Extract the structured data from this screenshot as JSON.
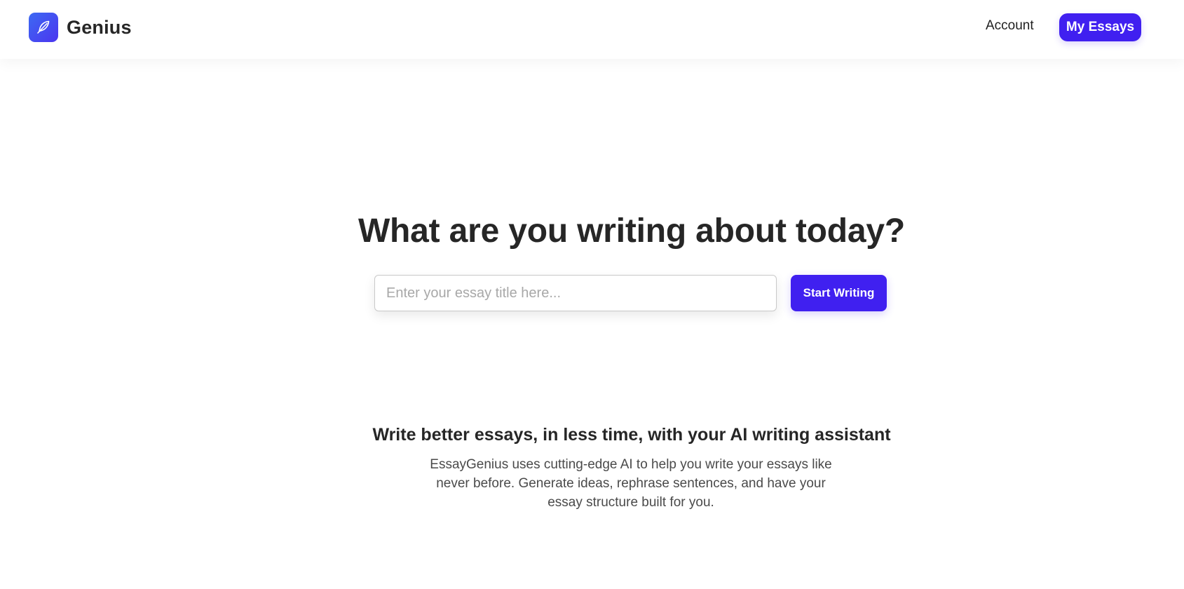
{
  "header": {
    "brand_name": "Genius",
    "logo_icon": "feather-icon",
    "nav": {
      "account_label": "Account",
      "my_essays_label": "My Essays"
    }
  },
  "hero": {
    "title": "What are you writing about today?",
    "input_placeholder": "Enter your essay title here...",
    "input_value": "",
    "start_button_label": "Start Writing"
  },
  "about": {
    "tagline": "Write better essays, in less time, with your AI writing assistant",
    "description": "EssayGenius uses cutting-edge AI to help you write your essays like never before. Generate ideas, rephrase sentences, and have your essay structure built for you."
  },
  "colors": {
    "accent": "#4020f0",
    "logo_gradient_start": "#3d6af2",
    "logo_gradient_end": "#4b35f0",
    "text": "#262626"
  }
}
